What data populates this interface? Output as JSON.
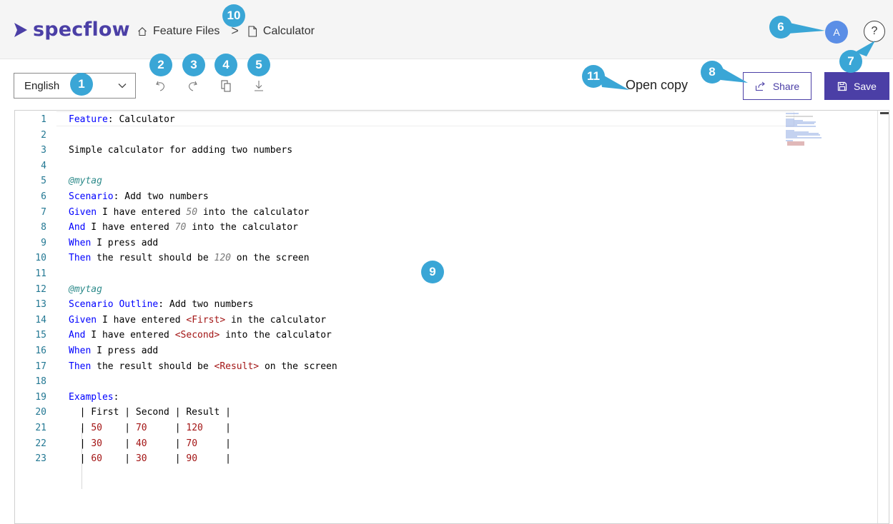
{
  "brand": {
    "name": "specflow",
    "color": "#4b3fa6"
  },
  "breadcrumb": {
    "home_icon": "home-icon",
    "root": "Feature Files",
    "separator": ">",
    "file_icon": "file-icon",
    "current": "Calculator"
  },
  "user": {
    "avatar_initial": "A"
  },
  "help": {
    "label": "?"
  },
  "toolbar": {
    "language": "English",
    "open_copy": "Open copy",
    "share_label": "Share",
    "save_label": "Save"
  },
  "editor": {
    "lines": [
      {
        "n": "1",
        "text": "Feature: Calculator"
      },
      {
        "n": "2",
        "text": ""
      },
      {
        "n": "3",
        "text": "Simple calculator for adding two numbers"
      },
      {
        "n": "4",
        "text": ""
      },
      {
        "n": "5",
        "text": "@mytag"
      },
      {
        "n": "6",
        "text": "Scenario: Add two numbers"
      },
      {
        "n": "7",
        "text": "Given I have entered 50 into the calculator"
      },
      {
        "n": "8",
        "text": "And I have entered 70 into the calculator"
      },
      {
        "n": "9",
        "text": "When I press add"
      },
      {
        "n": "10",
        "text": "Then the result should be 120 on the screen"
      },
      {
        "n": "11",
        "text": ""
      },
      {
        "n": "12",
        "text": "@mytag"
      },
      {
        "n": "13",
        "text": "Scenario Outline: Add two numbers"
      },
      {
        "n": "14",
        "text": "Given I have entered <First> in the calculator"
      },
      {
        "n": "15",
        "text": "And I have entered <Second> into the calculator"
      },
      {
        "n": "16",
        "text": "When I press add"
      },
      {
        "n": "17",
        "text": "Then the result should be <Result> on the screen"
      },
      {
        "n": "18",
        "text": ""
      },
      {
        "n": "19",
        "text": "Examples:"
      },
      {
        "n": "20",
        "text": "  | First | Second | Result |"
      },
      {
        "n": "21",
        "text": "  | 50    | 70     | 120    |"
      },
      {
        "n": "22",
        "text": "  | 30    | 40     | 70     |"
      },
      {
        "n": "23",
        "text": "  | 60    | 30     | 90     |"
      }
    ]
  },
  "markers": [
    "1",
    "2",
    "3",
    "4",
    "5",
    "6",
    "7",
    "8",
    "9",
    "10",
    "11"
  ],
  "colors": {
    "marker": "#3aa6d6",
    "keyword": "#0000ff",
    "placeholder": "#a31515",
    "line_number": "#237893"
  }
}
